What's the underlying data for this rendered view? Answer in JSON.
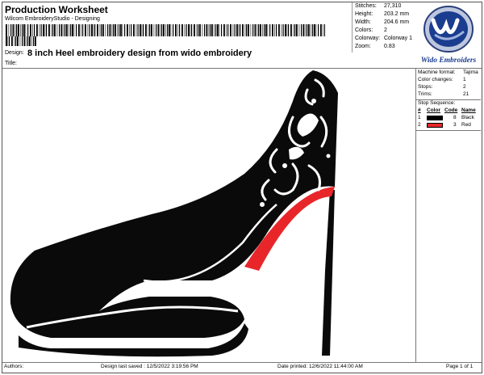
{
  "header": {
    "title": "Production Worksheet",
    "subtitle": "Wilcom EmbroideryStudio - Designing",
    "design_label": "Design:",
    "design_name": "8 inch Heel embroidery design from wido embroidery",
    "title_label": "Title:"
  },
  "stats": [
    {
      "label": "Stitches:",
      "value": "27,310"
    },
    {
      "label": "Height:",
      "value": "203.2 mm"
    },
    {
      "label": "Width:",
      "value": "204.6 mm"
    },
    {
      "label": "Colors:",
      "value": "2"
    },
    {
      "label": "Colorway:",
      "value": "Colorway 1"
    },
    {
      "label": "Zoom:",
      "value": "0.83"
    }
  ],
  "logo": {
    "text": "Wido Embroiders",
    "monogram": "WE"
  },
  "machine": [
    {
      "label": "Machine format:",
      "value": "Tajima"
    },
    {
      "label": "Color changes:",
      "value": "1"
    },
    {
      "label": "Stops:",
      "value": "2"
    },
    {
      "label": "Trims:",
      "value": "21"
    }
  ],
  "stop_sequence": {
    "title": "Stop Sequence:",
    "headers": [
      "#",
      "Color",
      "Code",
      "Name"
    ],
    "rows": [
      {
        "num": "1",
        "color": "#000000",
        "code": "8",
        "name": "Black"
      },
      {
        "num": "2",
        "color": "#e8262a",
        "code": "3",
        "name": "Red"
      }
    ]
  },
  "footer": {
    "authors": "Authors:",
    "saved": "Design last saved : 12/5/2022 3:19:56 PM",
    "printed": "Date printed: 12/6/2022 11:44:00 AM",
    "page": "Page 1 of 1"
  },
  "colors": {
    "shoe": "#0a0a0a",
    "sole_accent": "#e8262a",
    "logo_blue": "#1b3d8f"
  }
}
